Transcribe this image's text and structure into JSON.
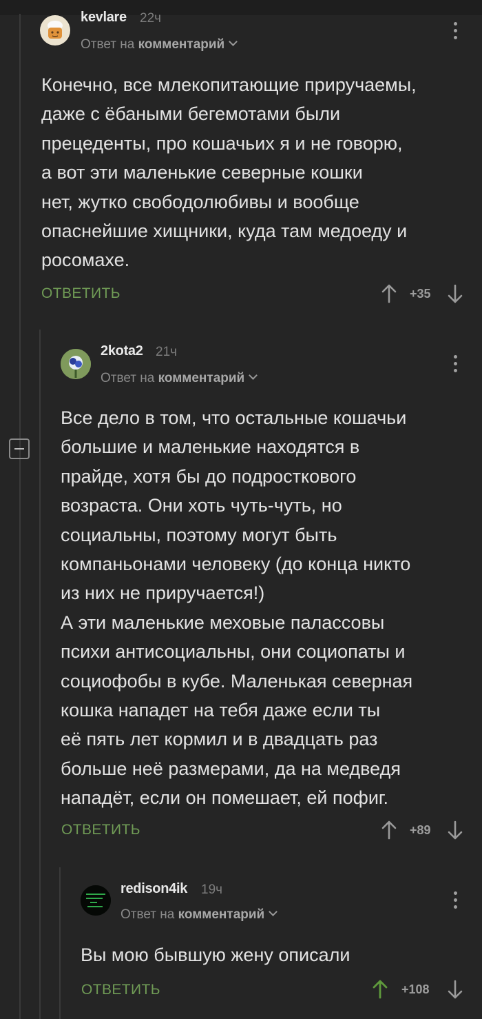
{
  "common": {
    "reply_prefix": "Ответ на",
    "reply_target": "комментарий",
    "reply_action": "ОТВЕТИТЬ",
    "accent_color": "#6f9a55",
    "upvoted_color": "#6f9a55"
  },
  "comments": [
    {
      "username": "kevlare",
      "time": "22ч",
      "text": "Конечно, все млекопитающие приручаемы,\nдаже с ёбаными бегемотами были\nпрецеденты, про кошачьих я и не говорю,\nа вот эти маленькие северные кошки\nнет, жутко свободолюбивы и вообще\nопаснейшие хищники, куда там медоеду и\nросомахе.",
      "score": "+35",
      "upvoted": false
    },
    {
      "username": "2kota2",
      "time": "21ч",
      "text": "Все дело в том, что остальные кошачьи\nбольшие и маленькие находятся в\nпрайде, хотя бы до подросткового\nвозраста. Они хоть чуть-чуть, но\nсоциальны, поэтому могут быть\nкомпаньонами человеку (до конца никто\nиз них не приручается!)\nА эти маленькие меховые палассовы\nпсихи антисоциальны, они социопаты и\nсоциофобы в кубе. Маленькая северная\nкошка нападет на тебя даже если ты\nеё пять лет кормил и в двадцать раз\nбольше неё размерами, да на медведя\nнападёт, если он помешает, ей пофиг.",
      "score": "+89",
      "upvoted": false
    },
    {
      "username": "redison4ik",
      "time": "19ч",
      "text": "Вы мою бывшую жену описали",
      "score": "+108",
      "upvoted": true
    }
  ]
}
